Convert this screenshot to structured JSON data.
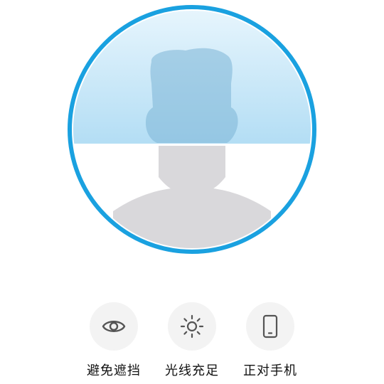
{
  "colors": {
    "ring": "#1aa1e0",
    "scan_band_top": "#dff2fc",
    "scan_band_bottom": "#a8d8f2",
    "silhouette": "#d9d8db",
    "tip_bg": "#f3f3f3",
    "icon_stroke": "#555555",
    "label_text": "#111111"
  },
  "face_frame": {
    "avatar_icon": "person-silhouette-icon"
  },
  "tips": [
    {
      "icon": "eye-icon",
      "label": "避免遮挡"
    },
    {
      "icon": "sun-icon",
      "label": "光线充足"
    },
    {
      "icon": "phone-icon",
      "label": "正对手机"
    }
  ]
}
